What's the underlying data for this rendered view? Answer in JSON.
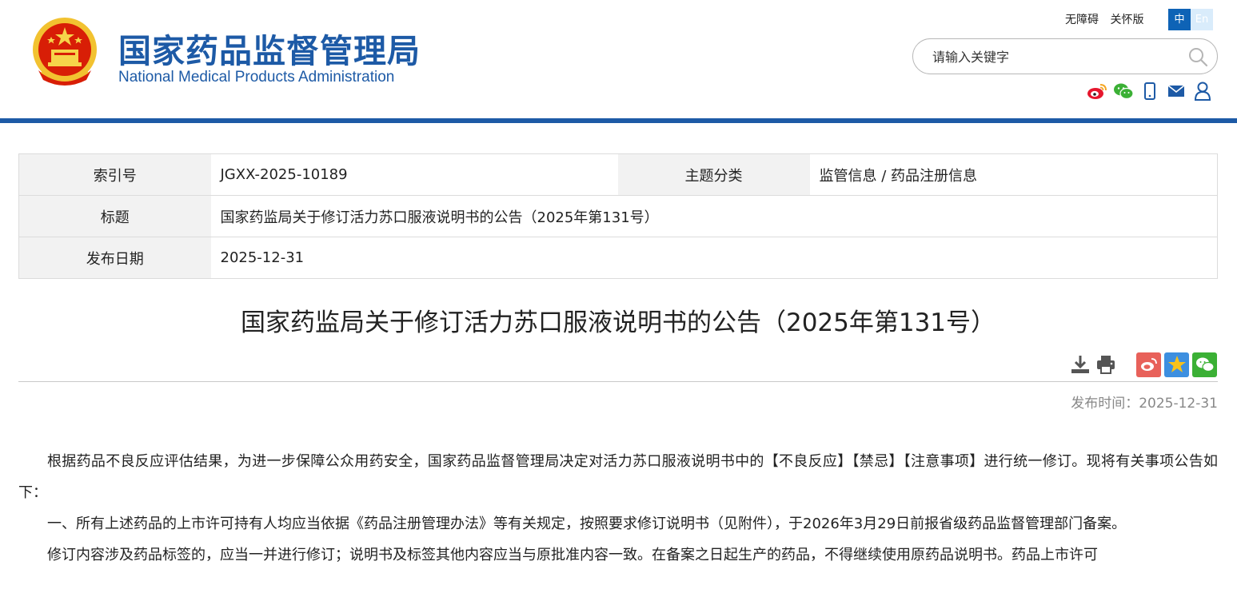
{
  "header": {
    "site_name_cn": "国家药品监督管理局",
    "site_name_en": "National Medical Products Administration",
    "top_links": [
      "无障碍",
      "关怀版"
    ],
    "lang": {
      "cn": "中",
      "en": "En"
    },
    "search_placeholder": "请输入关键字",
    "social_icons": [
      "weibo-icon",
      "wechat-icon",
      "mobile-icon",
      "mail-icon",
      "user-icon"
    ]
  },
  "info": {
    "index_label": "索引号",
    "index_value": "JGXX-2025-10189",
    "topic_label": "主题分类",
    "topic_value": "监管信息 / 药品注册信息",
    "title_label": "标题",
    "title_value": "国家药监局关于修订活力苏口服液说明书的公告（2025年第131号）",
    "date_label": "发布日期",
    "date_value": "2025-12-31"
  },
  "article": {
    "title": "国家药监局关于修订活力苏口服液说明书的公告（2025年第131号）",
    "pub_time": "发布时间：2025-12-31",
    "paragraphs": [
      "根据药品不良反应评估结果，为进一步保障公众用药安全，国家药品监督管理局决定对活力苏口服液说明书中的【不良反应】【禁忌】【注意事项】进行统一修订。现将有关事项公告如下：",
      "一、所有上述药品的上市许可持有人均应当依据《药品注册管理办法》等有关规定，按照要求修订说明书（见附件），于2026年3月29日前报省级药品监督管理部门备案。",
      "修订内容涉及药品标签的，应当一并进行修订；说明书及标签其他内容应当与原批准内容一致。在备案之日起生产的药品，不得继续使用原药品说明书。药品上市许可"
    ]
  },
  "colors": {
    "brand_blue": "#1d5aa6",
    "lang_active": "#0e63b6",
    "weibo": "#e6162d",
    "wechat": "#3bb035"
  }
}
